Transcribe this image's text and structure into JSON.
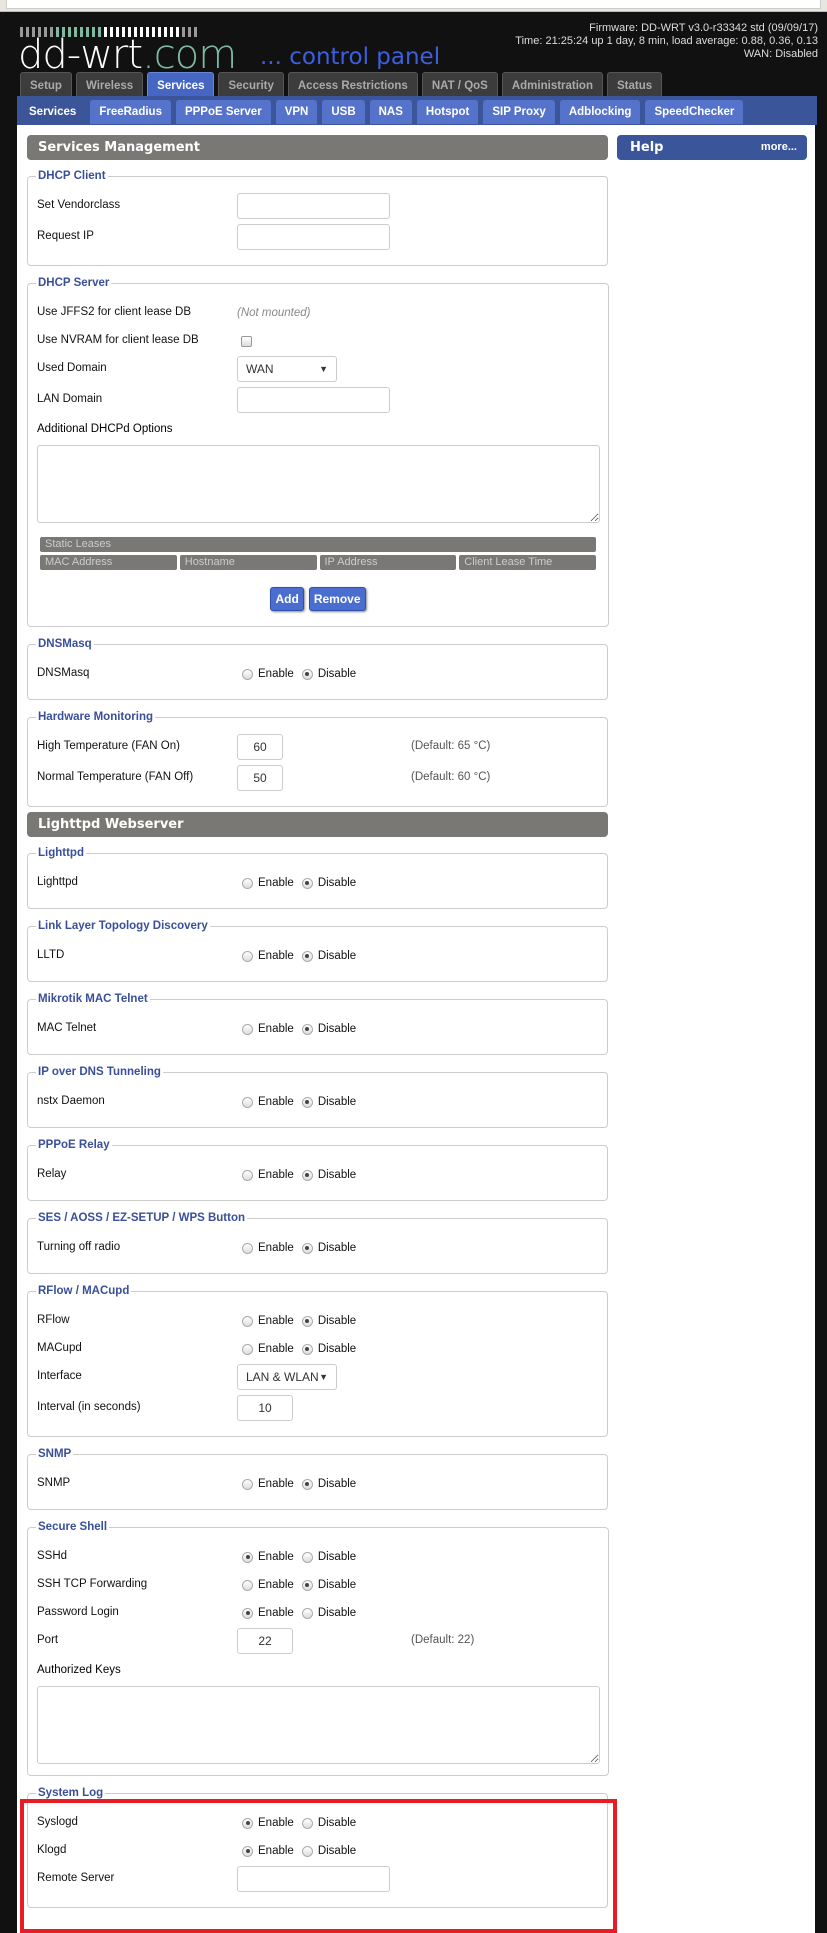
{
  "header": {
    "logo_text": "dd-wrt.com",
    "tagline": "... control panel",
    "firmware": "Firmware: DD-WRT v3.0-r33342 std (09/09/17)",
    "time": "Time: 21:25:24 up 1 day, 8 min, load average: 0.88, 0.36, 0.13",
    "wan": "WAN: Disabled"
  },
  "tabs": [
    {
      "label": "Setup"
    },
    {
      "label": "Wireless"
    },
    {
      "label": "Services",
      "active": true
    },
    {
      "label": "Security"
    },
    {
      "label": "Access Restrictions"
    },
    {
      "label": "NAT / QoS"
    },
    {
      "label": "Administration"
    },
    {
      "label": "Status"
    }
  ],
  "subtabs": [
    {
      "label": "Services",
      "active": true
    },
    {
      "label": "FreeRadius"
    },
    {
      "label": "PPPoE Server"
    },
    {
      "label": "VPN"
    },
    {
      "label": "USB"
    },
    {
      "label": "NAS"
    },
    {
      "label": "Hotspot"
    },
    {
      "label": "SIP Proxy"
    },
    {
      "label": "Adblocking"
    },
    {
      "label": "SpeedChecker"
    }
  ],
  "help": {
    "title": "Help",
    "more": "more..."
  },
  "radio_labels": {
    "enable": "Enable",
    "disable": "Disable"
  },
  "highlight_color": "#e81c24",
  "main": {
    "sections": [
      {
        "type": "header",
        "title": "Services Management"
      },
      {
        "type": "fieldset",
        "legend": "DHCP Client",
        "rows": [
          {
            "kind": "text",
            "label": "Set Vendorclass",
            "value": ""
          },
          {
            "kind": "text",
            "label": "Request IP",
            "value": ""
          }
        ]
      },
      {
        "type": "fieldset",
        "legend": "DHCP Server",
        "rows": [
          {
            "kind": "static",
            "label": "Use JFFS2 for client lease DB",
            "value": "(Not mounted)"
          },
          {
            "kind": "checkbox",
            "label": "Use NVRAM for client lease DB",
            "checked": false
          },
          {
            "kind": "select",
            "label": "Used Domain",
            "value": "WAN"
          },
          {
            "kind": "text",
            "label": "LAN Domain",
            "value": ""
          },
          {
            "kind": "textarea",
            "label": "Additional DHCPd Options",
            "value": ""
          },
          {
            "kind": "leases",
            "title": "Static Leases",
            "columns": [
              "MAC Address",
              "Hostname",
              "IP Address",
              "Client Lease Time"
            ],
            "add": "Add",
            "remove": "Remove"
          }
        ]
      },
      {
        "type": "fieldset",
        "legend": "DNSMasq",
        "rows": [
          {
            "kind": "radio",
            "label": "DNSMasq",
            "selected": "disable"
          }
        ]
      },
      {
        "type": "fieldset",
        "legend": "Hardware Monitoring",
        "rows": [
          {
            "kind": "number",
            "label": "High Temperature (FAN On)",
            "value": "60",
            "default": "(Default: 65 °C)"
          },
          {
            "kind": "number",
            "label": "Normal Temperature (FAN Off)",
            "value": "50",
            "default": "(Default: 60 °C)"
          }
        ]
      },
      {
        "type": "header",
        "title": "Lighttpd Webserver"
      },
      {
        "type": "fieldset",
        "legend": "Lighttpd",
        "rows": [
          {
            "kind": "radio",
            "label": "Lighttpd",
            "selected": "disable"
          }
        ]
      },
      {
        "type": "fieldset",
        "legend": "Link Layer Topology Discovery",
        "rows": [
          {
            "kind": "radio",
            "label": "LLTD",
            "selected": "disable"
          }
        ]
      },
      {
        "type": "fieldset",
        "legend": "Mikrotik MAC Telnet",
        "rows": [
          {
            "kind": "radio",
            "label": "MAC Telnet",
            "selected": "disable"
          }
        ]
      },
      {
        "type": "fieldset",
        "legend": "IP over DNS Tunneling",
        "rows": [
          {
            "kind": "radio",
            "label": "nstx Daemon",
            "selected": "disable"
          }
        ]
      },
      {
        "type": "fieldset",
        "legend": "PPPoE Relay",
        "rows": [
          {
            "kind": "radio",
            "label": "Relay",
            "selected": "disable"
          }
        ]
      },
      {
        "type": "fieldset",
        "legend": "SES / AOSS / EZ-SETUP / WPS Button",
        "rows": [
          {
            "kind": "radio",
            "label": "Turning off radio",
            "selected": "disable"
          }
        ]
      },
      {
        "type": "fieldset",
        "legend": "RFlow / MACupd",
        "rows": [
          {
            "kind": "radio",
            "label": "RFlow",
            "selected": "disable"
          },
          {
            "kind": "radio",
            "label": "MACupd",
            "selected": "disable"
          },
          {
            "kind": "select",
            "label": "Interface",
            "value": "LAN & WLAN"
          },
          {
            "kind": "number",
            "label": "Interval (in seconds)",
            "value": "10",
            "wide": true
          }
        ]
      },
      {
        "type": "fieldset",
        "legend": "SNMP",
        "rows": [
          {
            "kind": "radio",
            "label": "SNMP",
            "selected": "disable"
          }
        ]
      },
      {
        "type": "fieldset",
        "legend": "Secure Shell",
        "rows": [
          {
            "kind": "radio",
            "label": "SSHd",
            "selected": "enable"
          },
          {
            "kind": "radio",
            "label": "SSH TCP Forwarding",
            "selected": "disable"
          },
          {
            "kind": "radio",
            "label": "Password Login",
            "selected": "enable"
          },
          {
            "kind": "number",
            "label": "Port",
            "value": "22",
            "default": "(Default: 22)",
            "wide": true
          },
          {
            "kind": "textarea",
            "label": "Authorized Keys",
            "value": ""
          }
        ]
      },
      {
        "type": "fieldset",
        "legend": "System Log",
        "highlighted": true,
        "rows": [
          {
            "kind": "radio",
            "label": "Syslogd",
            "selected": "enable"
          },
          {
            "kind": "radio",
            "label": "Klogd",
            "selected": "enable"
          },
          {
            "kind": "text",
            "label": "Remote Server",
            "value": ""
          }
        ]
      }
    ]
  }
}
